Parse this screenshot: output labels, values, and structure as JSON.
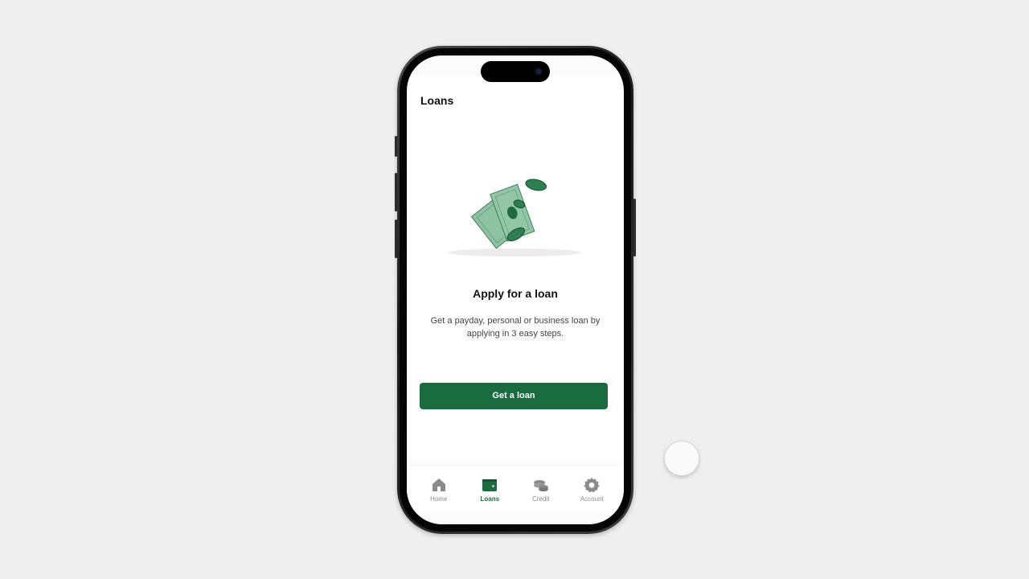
{
  "header": {
    "title": "Loans"
  },
  "main": {
    "headline": "Apply for a loan",
    "description": "Get a payday, personal or business loan by applying in 3 easy steps.",
    "cta_label": "Get a loan",
    "illustration_icon": "money-bills-coins-icon"
  },
  "nav": {
    "items": [
      {
        "label": "Home",
        "icon": "home-icon",
        "active": false
      },
      {
        "label": "Loans",
        "icon": "wallet-icon",
        "active": true
      },
      {
        "label": "Credit",
        "icon": "coins-icon",
        "active": false
      },
      {
        "label": "Account",
        "icon": "gear-icon",
        "active": false
      }
    ]
  },
  "colors": {
    "brand": "#1b6b41",
    "inactive": "#8a8a8a",
    "background": "#efefef"
  }
}
